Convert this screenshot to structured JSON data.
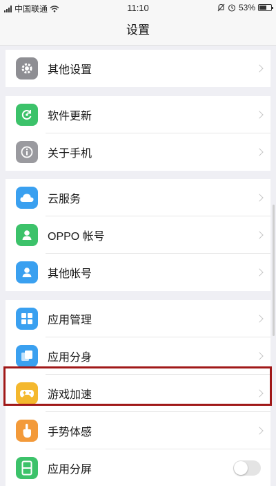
{
  "status_bar": {
    "carrier": "中国联通",
    "time": "11:10",
    "battery": "53%",
    "battery_level": 0.53
  },
  "header": {
    "title": "设置"
  },
  "groups": [
    {
      "items": [
        {
          "label": "其他设置",
          "icon": "gear-icon",
          "color": "#8e8e93"
        }
      ]
    },
    {
      "items": [
        {
          "label": "软件更新",
          "icon": "refresh-icon",
          "color": "#3cc26a"
        },
        {
          "label": "关于手机",
          "icon": "info-icon",
          "color": "#9a9a9f"
        }
      ]
    },
    {
      "items": [
        {
          "label": "云服务",
          "icon": "cloud-icon",
          "color": "#3aa0f0"
        },
        {
          "label": "OPPO 帐号",
          "icon": "person-icon",
          "color": "#3cc26a"
        },
        {
          "label": "其他帐号",
          "icon": "person-icon",
          "color": "#3aa0f0"
        }
      ]
    },
    {
      "items": [
        {
          "label": "应用管理",
          "icon": "grid-icon",
          "color": "#3aa0f0"
        },
        {
          "label": "应用分身",
          "icon": "clone-icon",
          "color": "#3aa0f0"
        },
        {
          "label": "游戏加速",
          "icon": "gamepad-icon",
          "color": "#f4b82e"
        },
        {
          "label": "手势体感",
          "icon": "hand-icon",
          "color": "#f39a3a"
        },
        {
          "label": "应用分屏",
          "icon": "split-screen-icon",
          "color": "#3cc26a",
          "toggle": false
        }
      ]
    }
  ],
  "highlight_color": "#a01818"
}
